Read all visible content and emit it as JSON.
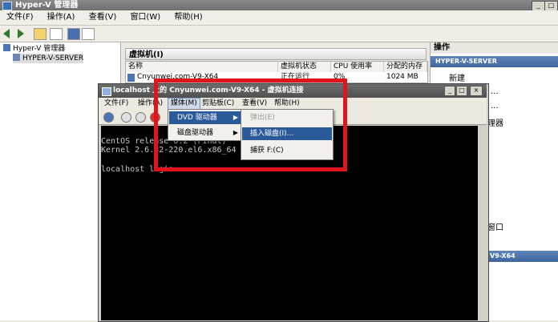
{
  "main_window": {
    "title": "Hyper-V 管理器",
    "menu": [
      "文件(F)",
      "操作(A)",
      "查看(V)",
      "窗口(W)",
      "帮助(H)"
    ]
  },
  "tree": {
    "root": "Hyper-V 管理器",
    "server": "HYPER-V-SERVER"
  },
  "vm_panel": {
    "header": "虚拟机(I)",
    "columns": [
      "名称",
      "虚拟机状态",
      "CPU 使用率",
      "分配的内存"
    ],
    "rows": [
      {
        "name": "Cnyunwei.com-V9-X64",
        "state": "正在运行",
        "cpu": "0%",
        "memory": "1024 MB"
      }
    ]
  },
  "actions": {
    "header": "操作",
    "server_band": "HYPER-V-SERVER",
    "new_item": "新建",
    "partial_1": "...",
    "partial_2": "...",
    "partial_3": "理器",
    "partial_4": "窗口",
    "vm_band": "V9-X64"
  },
  "vm_window": {
    "title": "localhost 上的 Cnyunwei.com-V9-X64 - 虚拟机连接",
    "menu": [
      "文件(F)",
      "操作(A)",
      "媒体(M)",
      "剪贴板(C)",
      "查看(V)",
      "帮助(H)"
    ],
    "console_lines": [
      "CentOS release 6.2 (Final)",
      "Kernel 2.6.32-220.el6.x86_64",
      "",
      "localhost login:"
    ]
  },
  "media_menu": {
    "items": [
      "DVD 驱动器",
      "磁盘驱动器"
    ]
  },
  "dvd_submenu": {
    "items": [
      "弹出(E)",
      "插入磁盘(I)...",
      "捕获 F:(C)"
    ]
  },
  "colors": {
    "highlight": "#2b5a9b",
    "annotation": "#e0151b",
    "action_band": "#4a72aa"
  }
}
